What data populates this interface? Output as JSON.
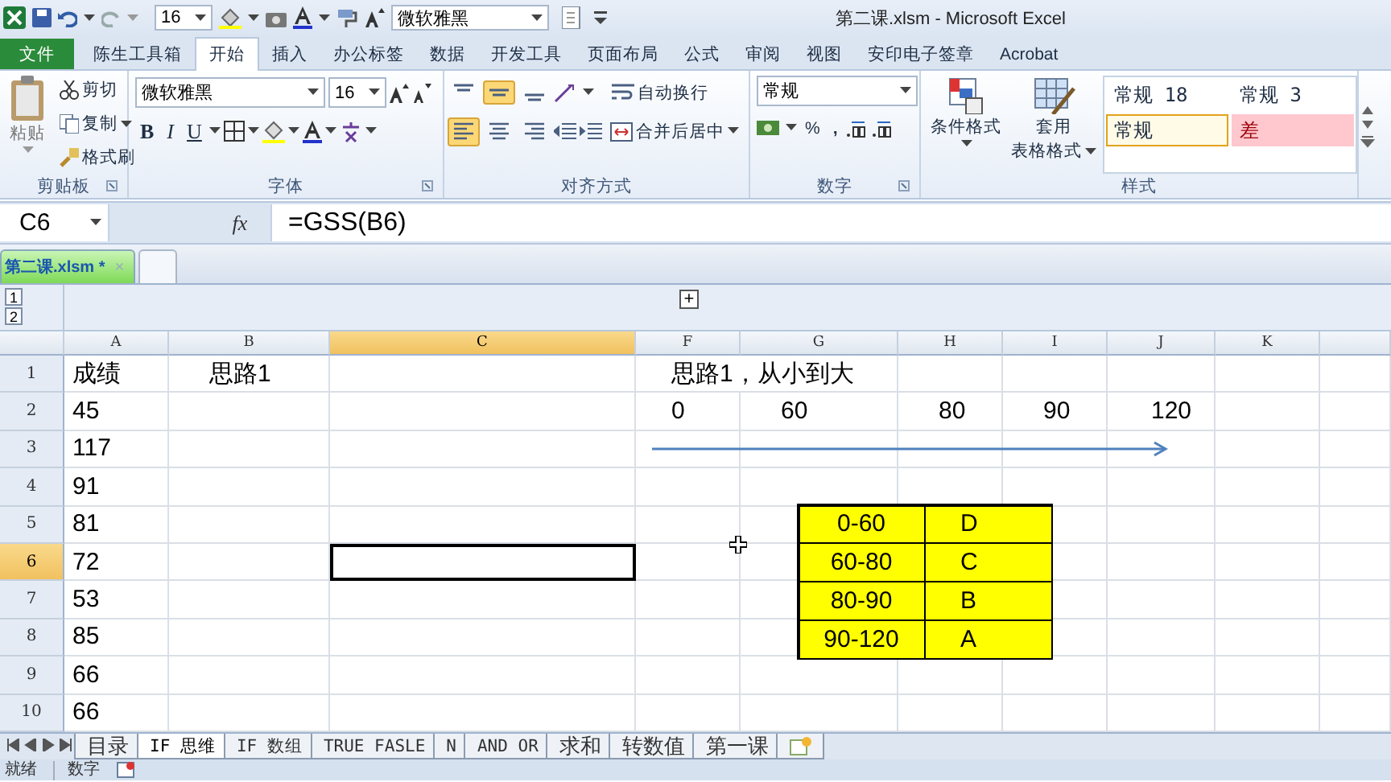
{
  "quick_access": {
    "font_size": "16",
    "font_name": "微软雅黑"
  },
  "title": "第二课.xlsm - Microsoft Excel",
  "ribbon_tabs": [
    {
      "label": "文件",
      "kind": "file",
      "selected": false
    },
    {
      "label": "陈生工具箱",
      "kind": "tab",
      "selected": false
    },
    {
      "label": "开始",
      "kind": "tab",
      "selected": true
    },
    {
      "label": "插入",
      "kind": "tab",
      "selected": false
    },
    {
      "label": "办公标签",
      "kind": "tab",
      "selected": false
    },
    {
      "label": "数据",
      "kind": "tab",
      "selected": false
    },
    {
      "label": "开发工具",
      "kind": "tab",
      "selected": false
    },
    {
      "label": "页面布局",
      "kind": "tab",
      "selected": false
    },
    {
      "label": "公式",
      "kind": "tab",
      "selected": false
    },
    {
      "label": "审阅",
      "kind": "tab",
      "selected": false
    },
    {
      "label": "视图",
      "kind": "tab",
      "selected": false
    },
    {
      "label": "安印电子签章",
      "kind": "tab",
      "selected": false
    },
    {
      "label": "Acrobat",
      "kind": "tab",
      "selected": false
    }
  ],
  "ribbon": {
    "clipboard": {
      "label": "剪贴板",
      "paste": "粘贴",
      "cut": "剪切",
      "copy": "复制",
      "format_painter": "格式刷"
    },
    "font": {
      "label": "字体",
      "font_name": "微软雅黑",
      "font_size": "16",
      "bold": "B",
      "italic": "I",
      "underline": "U"
    },
    "alignment": {
      "label": "对齐方式",
      "wrap_text": "自动换行",
      "merge": "合并后居中",
      "vertical": [
        {
          "selected": false
        },
        {
          "selected": true
        },
        {
          "selected": false
        }
      ],
      "horizontal": [
        {
          "selected": true
        },
        {
          "selected": false
        },
        {
          "selected": false
        }
      ]
    },
    "number": {
      "label": "数字",
      "format": "常规",
      "percent": "%",
      "comma": ","
    },
    "styles": {
      "label": "样式",
      "conditional": "条件格式",
      "table_format": [
        "套用",
        "表格格式"
      ],
      "gallery": [
        {
          "text": "常规 18",
          "kind": "normal",
          "selected": false
        },
        {
          "text": "常规 3",
          "kind": "normal",
          "selected": false
        },
        {
          "text": "常规",
          "kind": "normal",
          "selected": true
        },
        {
          "text": "差",
          "kind": "bad",
          "selected": false
        }
      ]
    }
  },
  "formula_bar": {
    "name_box": "C6",
    "fx": "fx",
    "formula": "=GSS(B6)"
  },
  "workbook_tab": {
    "label": "第二课.xlsm *",
    "close": "×"
  },
  "outline": {
    "levels": [
      "1",
      "2"
    ],
    "expand": "+"
  },
  "columns": [
    {
      "label": "A",
      "selected": false
    },
    {
      "label": "B",
      "selected": false
    },
    {
      "label": "C",
      "selected": true
    },
    {
      "label": "F",
      "selected": false
    },
    {
      "label": "G",
      "selected": false
    },
    {
      "label": "H",
      "selected": false
    },
    {
      "label": "I",
      "selected": false
    },
    {
      "label": "J",
      "selected": false
    },
    {
      "label": "K",
      "selected": false
    }
  ],
  "rows": [
    {
      "header": "1",
      "selected": false,
      "cells": {
        "A": "成绩",
        "B": "思路1",
        "F": "思路1，从小到大"
      }
    },
    {
      "header": "2",
      "selected": false,
      "cells": {
        "A": "45",
        "F": "0",
        "G": "60",
        "H": "80",
        "I": "90",
        "J": "120"
      }
    },
    {
      "header": "3",
      "selected": false,
      "cells": {
        "A": "117"
      }
    },
    {
      "header": "4",
      "selected": false,
      "cells": {
        "A": "91"
      }
    },
    {
      "header": "5",
      "selected": false,
      "cells": {
        "A": "81"
      }
    },
    {
      "header": "6",
      "selected": true,
      "cells": {
        "A": "72"
      }
    },
    {
      "header": "7",
      "selected": false,
      "cells": {
        "A": "53"
      }
    },
    {
      "header": "8",
      "selected": false,
      "cells": {
        "A": "85"
      }
    },
    {
      "header": "9",
      "selected": false,
      "cells": {
        "A": "66"
      }
    },
    {
      "header": "10",
      "selected": false,
      "cells": {
        "A": "66"
      }
    }
  ],
  "lookup_table": [
    [
      "0-60",
      "D"
    ],
    [
      "60-80",
      "C"
    ],
    [
      "80-90",
      "B"
    ],
    [
      "90-120",
      "A"
    ]
  ],
  "sheet_tabs": [
    {
      "label": "目录",
      "selected": false
    },
    {
      "label": "IF 思维",
      "selected": true
    },
    {
      "label": "IF 数组",
      "selected": false
    },
    {
      "label": "TRUE FASLE",
      "selected": false
    },
    {
      "label": "N",
      "selected": false
    },
    {
      "label": "AND OR",
      "selected": false
    },
    {
      "label": "求和",
      "selected": false
    },
    {
      "label": "转数值",
      "selected": false
    },
    {
      "label": "第一课",
      "selected": false
    }
  ],
  "status_bar": {
    "ready": "就绪",
    "mode": "数字"
  }
}
